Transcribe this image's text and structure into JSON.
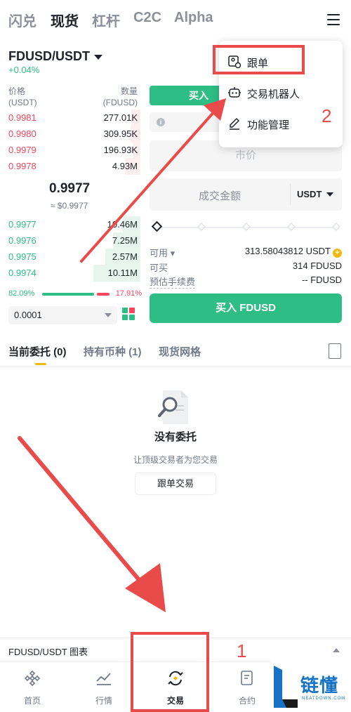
{
  "top_tabs": [
    "闪兑",
    "现货",
    "杠杆",
    "C2C",
    "Alpha"
  ],
  "pair": {
    "name": "FDUSD/USDT",
    "change": "+0.04%"
  },
  "orderbook": {
    "price_label": "价格",
    "price_unit": "(USDT)",
    "qty_label": "数量",
    "qty_unit": "(FDUSD)",
    "asks": [
      {
        "price": "0.9981",
        "qty": "277.01K",
        "depth": 0.18
      },
      {
        "price": "0.9980",
        "qty": "309.95K",
        "depth": 0.2
      },
      {
        "price": "0.9979",
        "qty": "196.93K",
        "depth": 0.14
      },
      {
        "price": "0.9978",
        "qty": "4.93M",
        "depth": 0.32
      }
    ],
    "last_price": "0.9977",
    "last_fiat": "≈ $0.9977",
    "bids": [
      {
        "price": "0.9977",
        "qty": "10.46M",
        "depth": 0.35
      },
      {
        "price": "0.9976",
        "qty": "7.25M",
        "depth": 0.55
      },
      {
        "price": "0.9975",
        "qty": "2.57M",
        "depth": 0.72
      },
      {
        "price": "0.9974",
        "qty": "10.11M",
        "depth": 0.95
      }
    ],
    "buy_ratio": "82.09%",
    "sell_ratio": "17.91%",
    "precision": "0.0001"
  },
  "form": {
    "buy_tab": "买入",
    "price_placeholder": "市价",
    "amount_placeholder": "成交金额",
    "amount_unit": "USDT",
    "available_label": "可用",
    "available_value": "313.58043812 USDT",
    "can_buy_label": "可买",
    "can_buy_value": "314 FDUSD",
    "fee_label": "预估手续费",
    "fee_value": "-- FDUSD",
    "buy_button": "买入 FDUSD"
  },
  "popup": {
    "items": [
      "跟单",
      "交易机器人",
      "功能管理"
    ]
  },
  "order_tabs": [
    "当前委托 (0)",
    "持有币种 (1)",
    "现货网格"
  ],
  "empty": {
    "title": "没有委托",
    "subtitle": "让顶级交易者为您交易",
    "button": "跟单交易"
  },
  "chart_bar": {
    "label": "FDUSD/USDT 图表"
  },
  "bottom_nav": [
    "首页",
    "行情",
    "交易",
    "合约"
  ],
  "watermark": {
    "text": "链懂",
    "sub": "NEATDOWN.COM"
  },
  "annotations": {
    "one": "1",
    "two": "2"
  },
  "colors": {
    "green": "#2ebd85",
    "red": "#f6465d",
    "yellow": "#f0b90b",
    "annotation": "#e94b4b"
  }
}
